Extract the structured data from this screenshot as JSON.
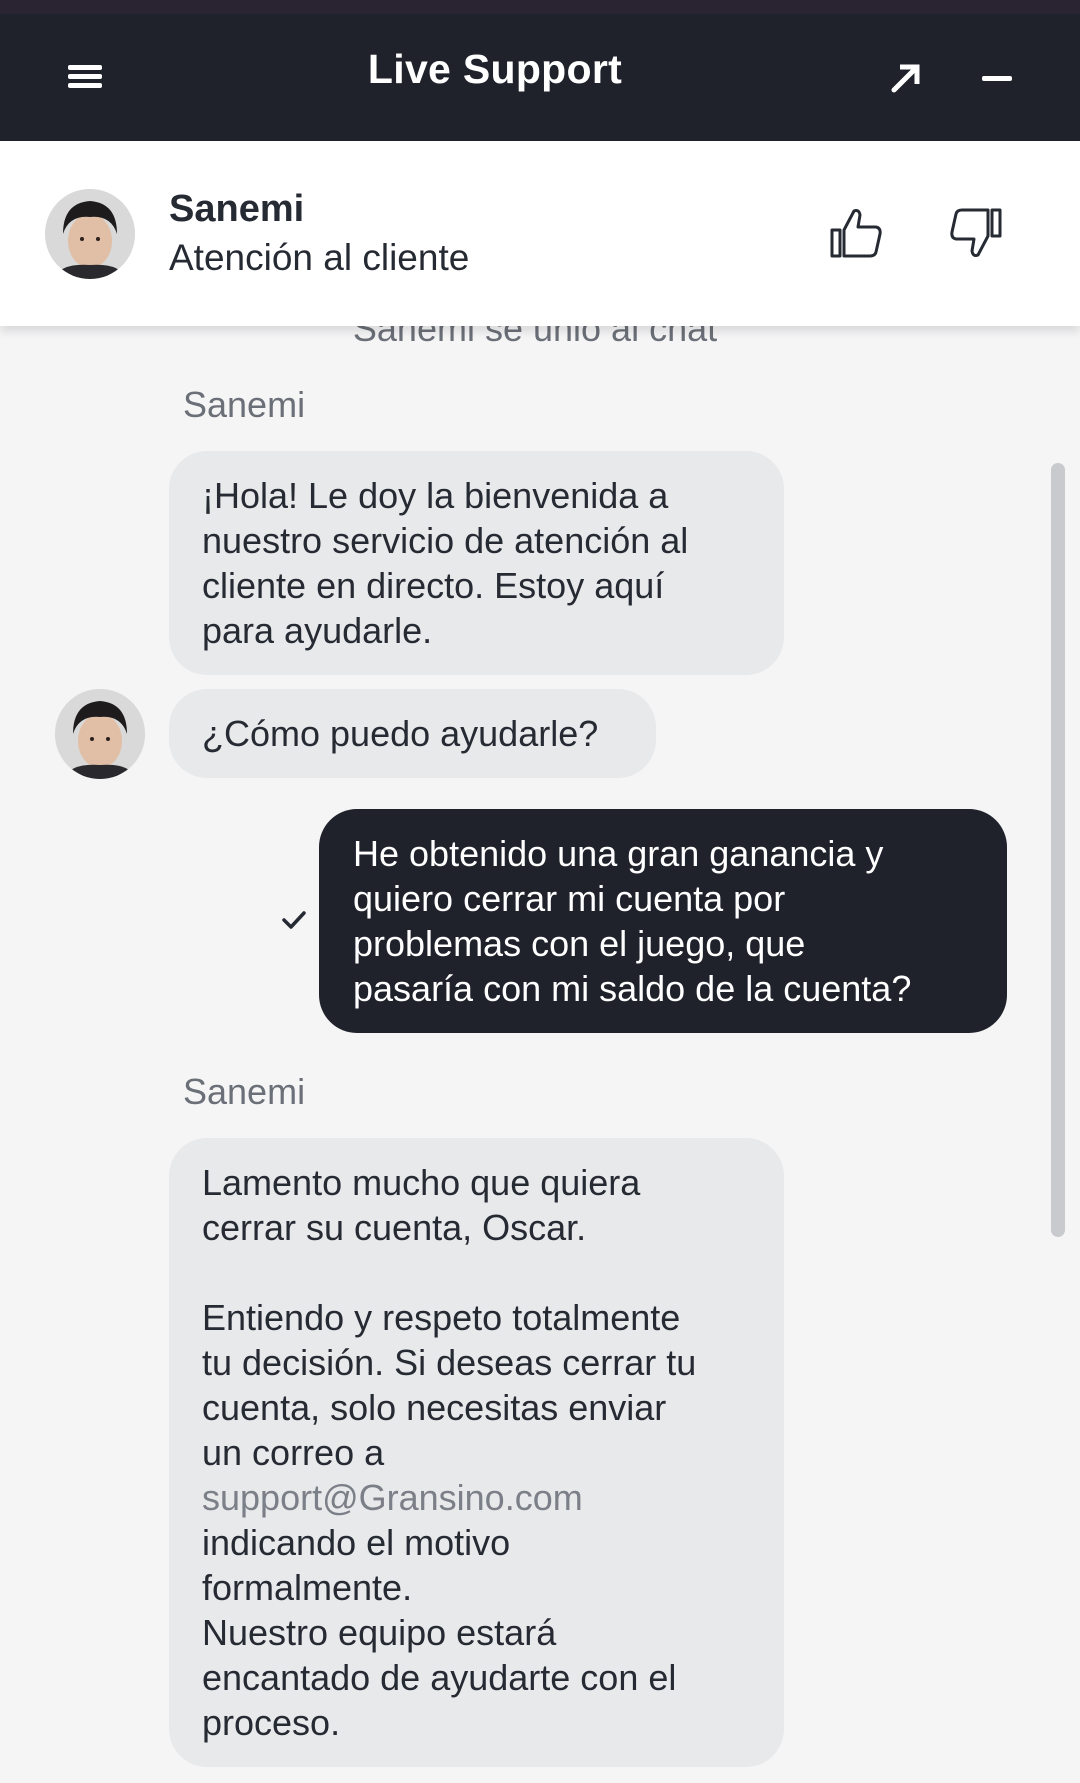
{
  "header": {
    "title": "Live Support",
    "menu_icon": "hamburger-icon",
    "expand_icon": "arrow-up-right-icon",
    "minimize_icon": "minus-icon",
    "background": "#1f222b"
  },
  "agent": {
    "name": "Sanemi",
    "role": "Atención al cliente",
    "rating_up_icon": "thumbs-up-icon",
    "rating_down_icon": "thumbs-down-icon"
  },
  "chat": {
    "system_message": "Sanemi se unió al chat",
    "messages": [
      {
        "sender": "Sanemi",
        "direction": "incoming",
        "lines": [
          "¡Hola! Le doy la bienvenida a",
          "nuestro servicio de atención al",
          "cliente en directo. Estoy aquí",
          "para ayudarle."
        ]
      },
      {
        "direction": "incoming",
        "lines": [
          "¿Cómo puedo ayudarle?"
        ]
      },
      {
        "direction": "outgoing",
        "status_icon": "checkmark-icon",
        "lines": [
          "He obtenido una gran ganancia y",
          "quiero cerrar mi cuenta por",
          "problemas con el juego, que",
          "pasaría con mi saldo de la cuenta?"
        ]
      },
      {
        "sender": "Sanemi",
        "direction": "incoming",
        "lines": [
          "Lamento mucho que quiera",
          "cerrar su cuenta, Oscar.",
          "",
          "Entiendo y respeto totalmente",
          "tu decisión. Si deseas cerrar tu",
          "cuenta, solo necesitas enviar",
          "un correo a",
          "support@Gransino.com",
          "indicando el motivo",
          "formalmente.",
          "Nuestro equipo estará",
          "encantado de ayudarte con el",
          "proceso."
        ]
      }
    ]
  },
  "colors": {
    "incoming_bubble": "#e8e9eb",
    "outgoing_bubble": "#1f222b",
    "link": "#7b7f87"
  }
}
